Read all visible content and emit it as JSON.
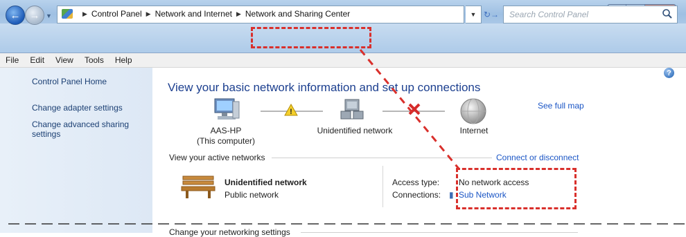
{
  "window": {
    "minimize_glyph": "—",
    "maximize_glyph": "□",
    "close_glyph": "X"
  },
  "nav": {
    "breadcrumbs": [
      "Control Panel",
      "Network and Internet",
      "Network and Sharing Center"
    ],
    "search_placeholder": "Search Control Panel"
  },
  "menu": [
    "File",
    "Edit",
    "View",
    "Tools",
    "Help"
  ],
  "sidebar": {
    "items": [
      {
        "label": "Control Panel Home"
      },
      {
        "label": "Change adapter settings"
      },
      {
        "label": "Change advanced sharing"
      },
      {
        "label": "settings"
      }
    ]
  },
  "main": {
    "heading": "View your basic network information and set up connections",
    "see_full_map": "See full map",
    "map": {
      "computer_name": "AAS-HP",
      "computer_sub": "(This computer)",
      "network": "Unidentified network",
      "internet": "Internet"
    },
    "active_networks_label": "View your active networks",
    "connect_link": "Connect or disconnect",
    "network_name": "Unidentified network",
    "network_type": "Public network",
    "access_type_label": "Access type:",
    "access_type_value": "No network access",
    "connections_label": "Connections:",
    "connections_value": "Sub Network",
    "change_settings_label": "Change your networking settings"
  },
  "colors": {
    "annotation": "#d9302c",
    "link": "#1a55c5",
    "heading": "#1c3f8f"
  }
}
